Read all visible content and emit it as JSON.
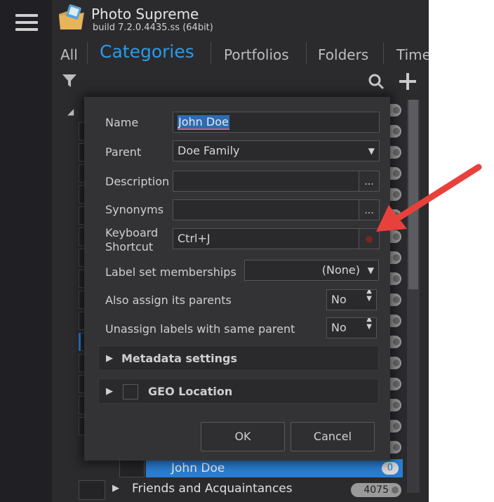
{
  "app": {
    "title": "Photo Supreme",
    "build": "build 7.2.0.4435.ss (64bit)"
  },
  "tabs": [
    {
      "label": "All"
    },
    {
      "label": "Categories",
      "active": true
    },
    {
      "label": "Portfolios"
    },
    {
      "label": "Folders"
    },
    {
      "label": "Time"
    }
  ],
  "icons": {
    "menu": "hamburger-icon",
    "logo": "photo-supreme-logo",
    "filter": "filter-icon",
    "search": "search-icon",
    "add": "plus-icon"
  },
  "tree": {
    "selected_item": {
      "label": "John Doe",
      "count": "0"
    },
    "next_item": {
      "label": "Friends and Acquaintances",
      "count": "4075"
    }
  },
  "dialog": {
    "name": {
      "label": "Name",
      "value": "John Doe"
    },
    "parent": {
      "label": "Parent",
      "value": "Doe Family"
    },
    "description": {
      "label": "Description",
      "value": "",
      "button": "..."
    },
    "synonyms": {
      "label": "Synonyms",
      "value": "",
      "button": "..."
    },
    "shortcut": {
      "label_line1": "Keyboard",
      "label_line2": "Shortcut",
      "value": "Ctrl+J"
    },
    "label_set": {
      "label": "Label set memberships",
      "value": "(None)"
    },
    "assign_parents": {
      "label": "Also assign its parents",
      "value": "No"
    },
    "unassign_same_parent": {
      "label": "Unassign labels with same parent",
      "value": "No"
    },
    "metadata_section": {
      "label": "Metadata settings"
    },
    "geo_section": {
      "label": "GEO Location"
    },
    "ok_label": "OK",
    "cancel_label": "Cancel"
  },
  "colors": {
    "accent": "#2b9be8",
    "selection": "#2a7ed3",
    "annotation_arrow": "#e8413c",
    "background": "#2b2b2e",
    "dialog": "#333336"
  }
}
